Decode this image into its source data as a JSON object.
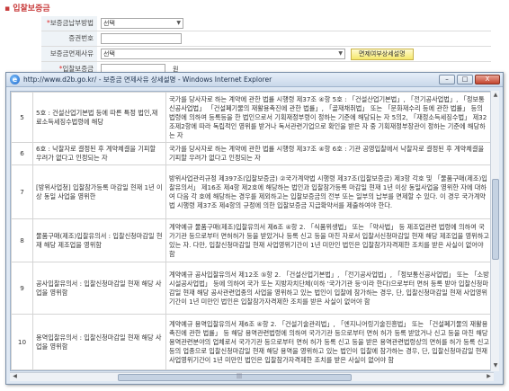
{
  "section": {
    "title": "▪ 입찰보증금"
  },
  "form": {
    "rows": [
      {
        "label": "보증금납부방법",
        "required": true,
        "type": "select",
        "value": "선택"
      },
      {
        "label": "증권번호",
        "required": false,
        "type": "text",
        "value": ""
      },
      {
        "label": "보증금면제사유",
        "required": false,
        "type": "select-wide",
        "value": "선택",
        "button": "면제여부상세설명"
      },
      {
        "label": "입찰보증금",
        "required": true,
        "type": "amount",
        "value": "",
        "unit": "원"
      }
    ]
  },
  "popup": {
    "title": "http://www.d2b.go.kr/ - 보증금 면제사유 상세설명 - Windows Internet Explorer",
    "buttons": {
      "minimize": "–",
      "maximize": "□",
      "close": "X"
    },
    "rows": [
      {
        "num": "5",
        "cond": "5호 : 건설산업기본법 등에 따른 특정 법인,재료소득세징수법령에 해당",
        "desc": "국가를 당사자로 하는 계약에 관한 법률 시행령 제37조 ④항 5호 : 「건설산업기본법」, 「전기공사업법」, 「정보통신공사업법」 「건설폐기물의 재활용촉진에 관한 법률」, 「골재채취법」 또는 「문화재수리 등에 관한 법률」 등의 법령에 의하여 등록등을 한 법인으로서 기획재정부령이 정하는 기준에 해당되는 자 5의2, 「재정소득세징수법」 제32조제2항에 따라 독립적인 영위를 받거나 독서관련기업으로 확인을 받은 자 중 기획재정부장관이 정하는 기준에 해당하는 자"
      },
      {
        "num": "6",
        "cond": "6호 : 낙찰자로 결정된 후 계약체결을 기피할 우려가 없다고 인정되는 자",
        "desc": "국가를 당사자로 하는 계약에 관한 법률 시행령 제37조 ④항 6호 : 기관 공영입찰에서 낙찰자로 결정된 후 계약체결을 기피할 우려가 없다고 인정되는 자"
      },
      {
        "num": "7",
        "cond": "[방위사업청] 입찰참가등록 마감일 현재 1년 이상 동일 사업을 영위한",
        "desc": "방위사업관리규정 제397조(입찰보증금) ②국가계약법 시행령 제37조(입찰보증금) 제3항 각호 및 「물품구매(제조)입찰유의서」 제16조 제4항 제2호에 해당하는 법인과 입찰참가등록 마감일 현재 1년 이상 동일사업을 영위한 자에 대하여 다음 각 호에 해당하는 경우를 제외하고는 입찰보증금의 전부 또는 일부의 납부를 면제할 수 있다. 이 경우 국가계약법 시행령 제37조 제4항의 규정에 의한 입찰보증금 지급확약서를 제출하여야 한다."
      },
      {
        "num": "8",
        "cond": "물품구매(제조)입찰유의서 : 입찰신청마감일 현재 해당 제조업을 영위함",
        "desc": "계약예규 물품구매(제조)입찰유의서 제6조 ④항 2. 「식품위생법」 또는 「약사법」 등 제조업관련 법령에 의하여 국가기관 등으로부터 면허허가 등을 받았거나 등록 신고 등을 마친 자로서 입찰서신청마감일 현재 해당 제조업을 영위하고 있는 자. 다만, 입찰신청마감일 현재 사업영위기간이 1년 미만인 법인은 입찰참가자격제한 조치를 받은 사실이 없어야 함"
      },
      {
        "num": "9",
        "cond": "공사입찰유의서 : 입찰신청마감일 현재 해당 사업을 영위함",
        "desc": "계약예규 공사입찰유의서 제12조 ⑤항 2. 「건설산업기본법」, 「전기공사업법」, 「정보통신공사업법」 또는 「소방시설공사업법」 등에 의하여 국가 또는 지방자치단체(이하 '국가기관 등'이라 한다)으로부터 면허 등록 받아 입찰신청마감일 현재 해당 공사관련업종의 사업을 영위하고 있는 법인이 입찰에 참가하는 경우, 단, 입찰신청마감일 현재 사업영위기간이 1년 미만인 법인은 입찰참가자격제한 조치를 받은 사실이 없어야 함"
      },
      {
        "num": "10",
        "cond": "용역입찰유의서 : 입찰신청마감일 현재 해당 사업을 영위함",
        "desc": "계약예규 용역입찰유의서 제6조 ④항 2. 「건설기술관리법」, 「엔지니어링기술진흥법」 또는 「건설폐기물의 재활용촉진에 관한 법률」 등 해당 용역관련법령에 의하여 국가기관 등으로부터 면허 허가 등록 받았거나 신고 등을 마친 해당 용역관련분야의 업체로서 국가기관 등으로부터 면허 허가 등록 신고 등을 받은 용역관련법령상의 면허를 허가 등록 신고 등의 업종으로 입찰신청마감일 현재 해당 용역을 영위하고 있는 법인이 입찰에 참가하는 경우, 단, 입찰신청마감일 현재 사업영위기간이 1년 미만인 법인은 입찰참가자격제한 조치를 받은 사실이 없어야 함"
      }
    ]
  },
  "icons": {
    "browser": "ie-icon"
  }
}
